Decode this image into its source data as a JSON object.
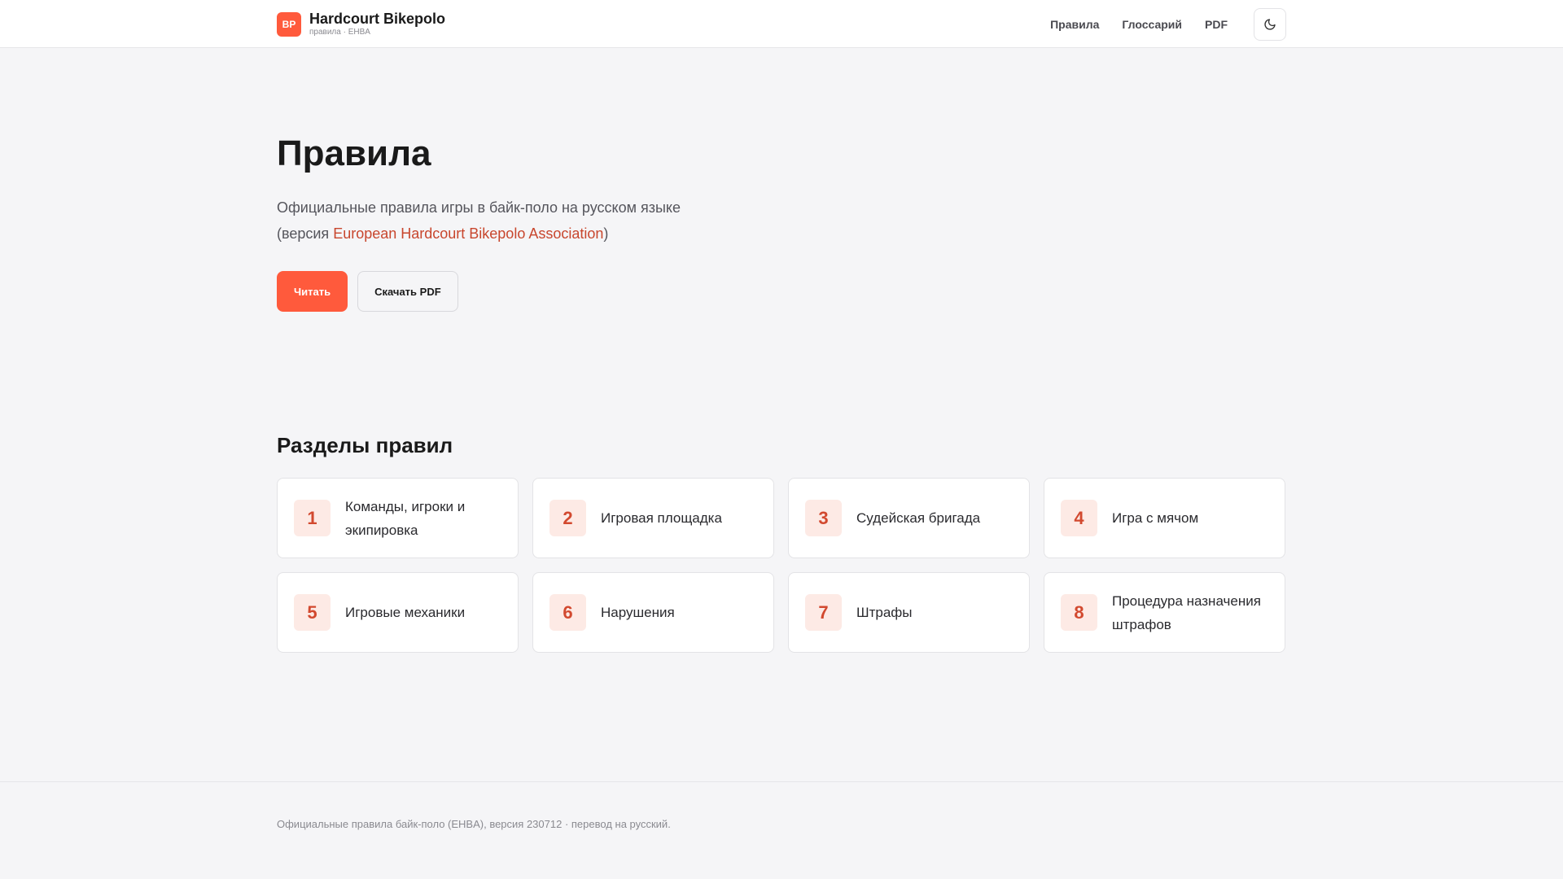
{
  "header": {
    "logo_text": "BP",
    "title": "Hardcourt Bikepolo",
    "subtitle": "правила · EHBA",
    "nav": [
      {
        "label": "Правила"
      },
      {
        "label": "Глоссарий"
      },
      {
        "label": "PDF"
      }
    ],
    "theme_toggle_icon": "moon-icon"
  },
  "hero": {
    "title": "Правила",
    "description_line": "Официальные правила игры в байк-поло на русском языке",
    "version_prefix": "(версия ",
    "version_link": "European Hardcourt Bikepolo Association",
    "version_suffix": ")",
    "read_button": "Читать",
    "download_button": "Скачать PDF"
  },
  "sections": {
    "title": "Разделы правил",
    "items": [
      {
        "num": "1",
        "label": "Команды, игроки и экипировка"
      },
      {
        "num": "2",
        "label": "Игровая площадка"
      },
      {
        "num": "3",
        "label": "Судейская бригада"
      },
      {
        "num": "4",
        "label": "Игра с мячом"
      },
      {
        "num": "5",
        "label": "Игровые механики"
      },
      {
        "num": "6",
        "label": "Нарушения"
      },
      {
        "num": "7",
        "label": "Штрафы"
      },
      {
        "num": "8",
        "label": "Процедура назначения штрафов"
      }
    ]
  },
  "footer": {
    "text": "Официальные правила байк-поло (EHBA), версия 230712 · перевод на русский."
  },
  "colors": {
    "accent": "#ff5a3c",
    "link": "#c8462d",
    "background": "#f5f5f7",
    "badge_bg": "#fdeae5"
  }
}
